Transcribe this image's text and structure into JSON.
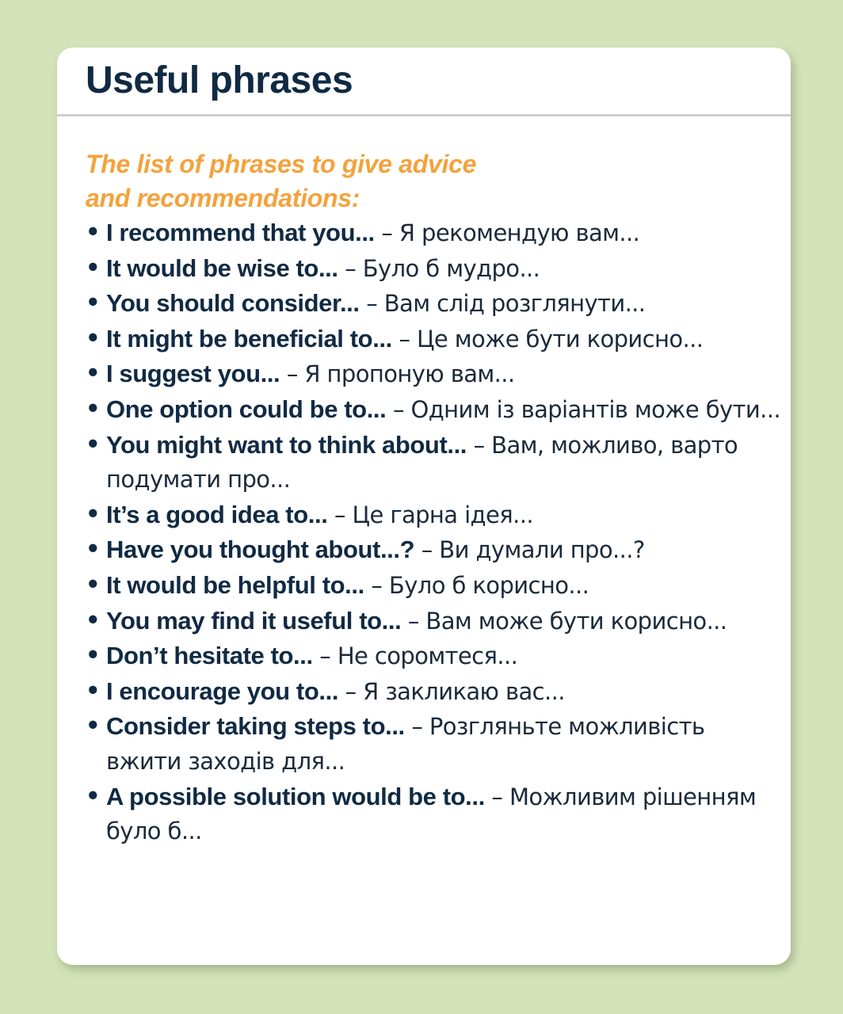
{
  "card": {
    "title": "Useful phrases",
    "subtitle_lines": [
      "The list of phrases to give advice",
      "and recommendations:"
    ],
    "bullet": "•",
    "phrases": [
      {
        "en": "I recommend that you...",
        "uk": " – Я рекомендую вам..."
      },
      {
        "en": "It would be wise to...",
        "uk": " – Було б мудро..."
      },
      {
        "en": "You should consider...",
        "uk": " – Вам слід розглянути..."
      },
      {
        "en": "It might be beneficial to...",
        "uk": " – Це може бути корисно..."
      },
      {
        "en": "I suggest you...",
        "uk": " – Я пропоную вам..."
      },
      {
        "en": "One option could be to...",
        "uk": " – Одним із варіантів може бути..."
      },
      {
        "en": "You might want to think about...",
        "uk": " – Вам, можливо, варто подумати про..."
      },
      {
        "en": "It’s a good idea to...",
        "uk": " – Це гарна ідея..."
      },
      {
        "en": "Have you thought about...?",
        "uk": " – Ви думали про...?"
      },
      {
        "en": "It would be helpful to...",
        "uk": " – Було б корисно..."
      },
      {
        "en": "You may find it useful to...",
        "uk": " – Вам може бути корисно..."
      },
      {
        "en": "Don’t hesitate to...",
        "uk": " – Не соромтеся..."
      },
      {
        "en": "I encourage you to...",
        "uk": " – Я закликаю вас..."
      },
      {
        "en": "Consider taking steps to...",
        "uk": " – Розгляньте можливість вжити заходів для..."
      },
      {
        "en": "A possible solution would be to...",
        "uk": " – Можливим рішенням було б..."
      }
    ],
    "colors": {
      "background": "#d3e2b8",
      "card": "#ffffff",
      "title": "#102a43",
      "subtitle": "#f4a23c",
      "body_text": "#1b2a3a",
      "divider": "#cfcfcf"
    }
  }
}
